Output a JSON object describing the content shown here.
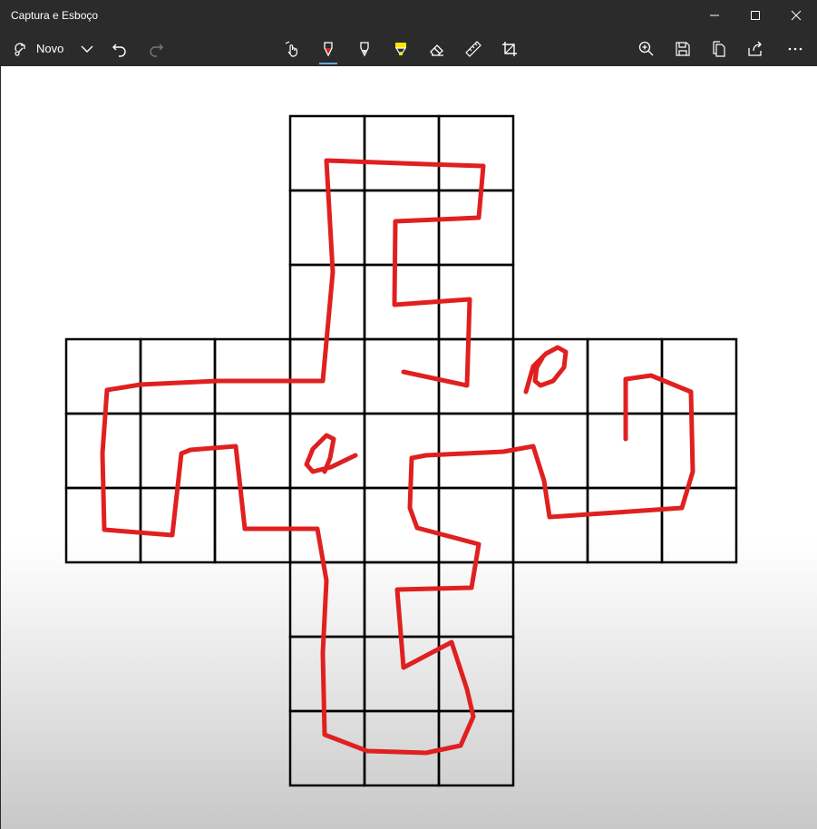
{
  "window": {
    "title": "Captura e Esboço"
  },
  "toolbar": {
    "new_label": "Novo",
    "tools": [
      "touch-writing-icon",
      "ballpoint-pen-icon",
      "pencil-icon",
      "highlighter-icon",
      "eraser-icon",
      "ruler-icon",
      "crop-icon"
    ],
    "actions": [
      "zoom-icon",
      "save-icon",
      "copy-icon",
      "share-icon",
      "more-icon"
    ]
  },
  "colors": {
    "chrome": "#2b2b2b",
    "ink": "#e02020",
    "grid": "#000000",
    "highlighter": "#ffe600"
  }
}
